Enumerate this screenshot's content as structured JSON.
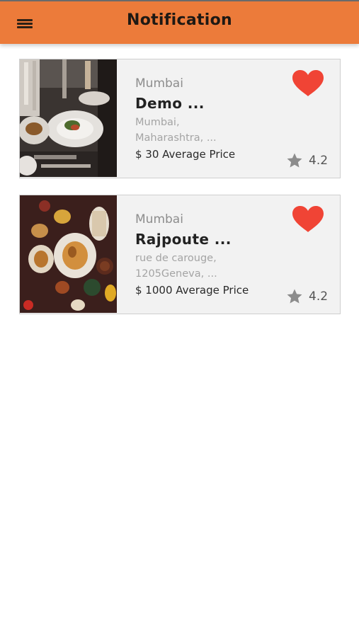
{
  "header": {
    "title": "Notification",
    "menu_icon": "hamburger-menu-icon",
    "background_color": "#ec7b3a"
  },
  "notifications": [
    {
      "city": "Mumbai",
      "name": "Demo ...",
      "address_line1": "Mumbai,",
      "address_line2": "Maharashtra, ...",
      "price": "$ 30 Average Price",
      "rating": "4.2",
      "favorite": true,
      "favorite_icon": "heart-icon",
      "rating_icon": "star-icon",
      "image_icon": "restaurant-photo"
    },
    {
      "city": "Mumbai",
      "name": "Rajpoute ...",
      "address_line1": "rue de carouge,",
      "address_line2": "1205Geneva, ...",
      "price": "$ 1000 Average Price",
      "rating": "4.2",
      "favorite": true,
      "favorite_icon": "heart-icon",
      "rating_icon": "star-icon",
      "image_icon": "food-platter-photo"
    }
  ],
  "colors": {
    "heart": "#f04435",
    "star": "#8c8c8c"
  }
}
